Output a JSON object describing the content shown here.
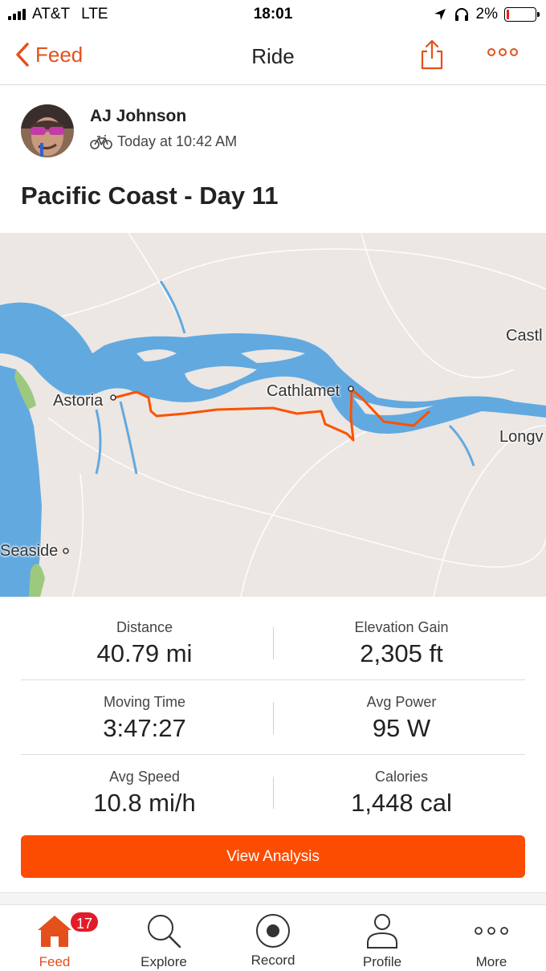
{
  "status_bar": {
    "carrier": "AT&T",
    "network": "LTE",
    "time": "18:01",
    "battery_pct": "2%",
    "battery_level": 0.02,
    "battery_color": "#e02020"
  },
  "nav": {
    "back_label": "Feed",
    "title": "Ride",
    "icons": [
      "chevron-left-icon",
      "share-icon",
      "more-icon"
    ]
  },
  "activity": {
    "athlete_name": "AJ Johnson",
    "activity_type_icon": "bike-icon",
    "timestamp": "Today at 10:42 AM",
    "title": "Pacific Coast - Day 11"
  },
  "map": {
    "labels": {
      "astoria": "Astoria",
      "cathlamet": "Cathlamet",
      "castle": "Castl",
      "longview": "Longv",
      "seaside": "Seaside"
    },
    "route_color": "#fc5200",
    "water_color": "#62a9e0",
    "land_color": "#ece7e3"
  },
  "stats": {
    "distance": {
      "label": "Distance",
      "value": "40.79 mi"
    },
    "elevation": {
      "label": "Elevation Gain",
      "value": "2,305 ft"
    },
    "moving_time": {
      "label": "Moving Time",
      "value": "3:47:27"
    },
    "avg_power": {
      "label": "Avg Power",
      "value": "95 W"
    },
    "avg_speed": {
      "label": "Avg Speed",
      "value": "10.8 mi/h"
    },
    "calories": {
      "label": "Calories",
      "value": "1,448 cal"
    }
  },
  "actions": {
    "view_analysis": "View Analysis",
    "button_color": "#fc4c02"
  },
  "tabbar": {
    "feed": {
      "label": "Feed",
      "badge": "17",
      "icon": "home-icon"
    },
    "explore": {
      "label": "Explore",
      "icon": "search-icon"
    },
    "record": {
      "label": "Record",
      "icon": "record-icon"
    },
    "profile": {
      "label": "Profile",
      "icon": "person-icon"
    },
    "more": {
      "label": "More",
      "icon": "more-icon"
    },
    "active_color": "#e4501b"
  }
}
